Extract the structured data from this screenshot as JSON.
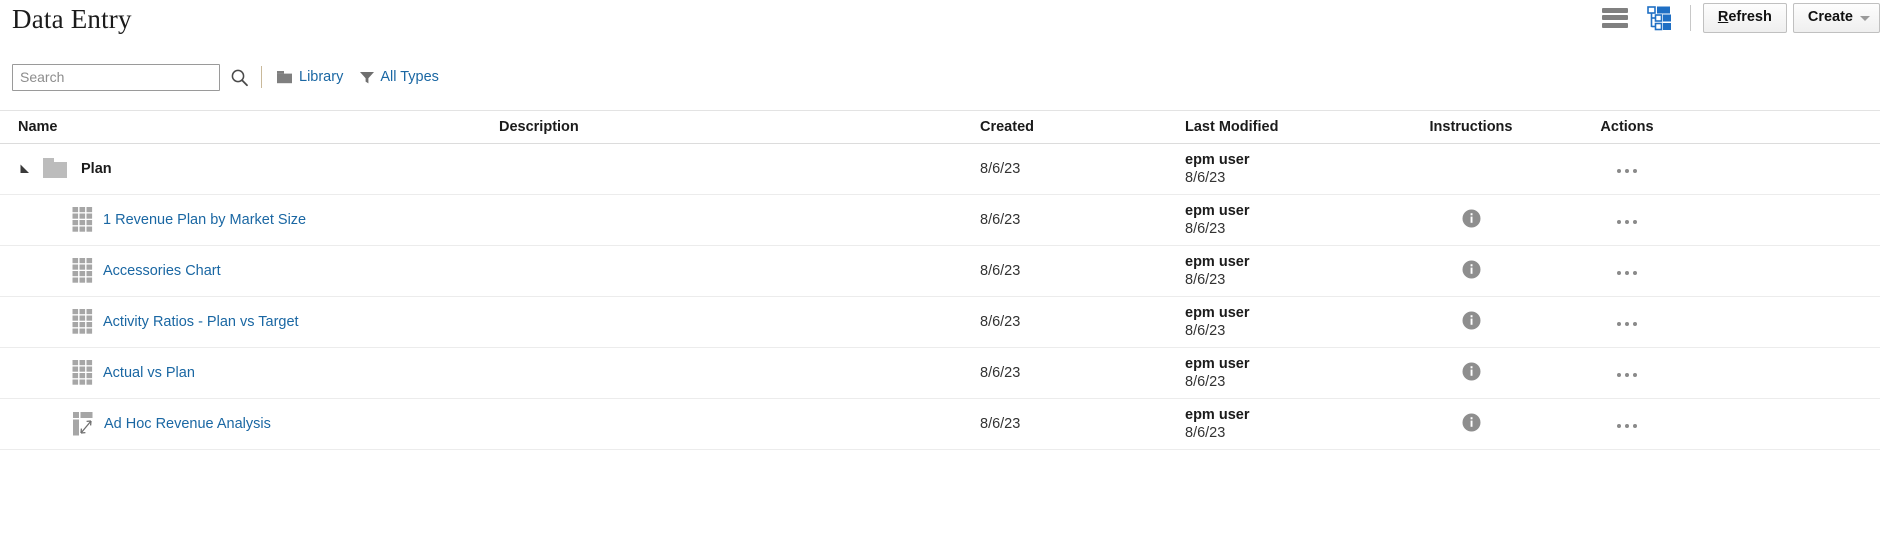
{
  "header": {
    "title": "Data Entry",
    "view_toggle": [
      {
        "name": "list-view-icon",
        "label": "List View",
        "selected": false
      },
      {
        "name": "tree-view-icon",
        "label": "Tree View",
        "selected": true
      }
    ],
    "refresh_label": "Refresh",
    "refresh_accesskey": "R",
    "refresh_rest": "efresh",
    "create_label": "Create"
  },
  "toolbar": {
    "search_placeholder": "Search",
    "search_value": "",
    "search_icon": "search-icon",
    "library_label": "Library",
    "library_icon": "folder-icon",
    "all_types_label": "All Types",
    "all_types_icon": "filter-funnel-icon"
  },
  "table": {
    "columns": {
      "name": "Name",
      "description": "Description",
      "created": "Created",
      "last_modified": "Last Modified",
      "instructions": "Instructions",
      "actions": "Actions"
    },
    "rows": [
      {
        "type": "folder",
        "icon": "folder-icon",
        "expanded": true,
        "name": "Plan",
        "description": "",
        "created": "8/6/23",
        "modified_user": "epm user",
        "modified_date": "8/6/23",
        "has_instructions": false
      },
      {
        "type": "form",
        "icon": "grid-icon",
        "name": "1 Revenue Plan by Market Size",
        "description": "",
        "created": "8/6/23",
        "modified_user": "epm user",
        "modified_date": "8/6/23",
        "has_instructions": true
      },
      {
        "type": "form",
        "icon": "grid-icon",
        "name": "Accessories Chart",
        "description": "",
        "created": "8/6/23",
        "modified_user": "epm user",
        "modified_date": "8/6/23",
        "has_instructions": true
      },
      {
        "type": "form",
        "icon": "grid-icon",
        "name": "Activity Ratios - Plan vs Target",
        "description": "",
        "created": "8/6/23",
        "modified_user": "epm user",
        "modified_date": "8/6/23",
        "has_instructions": true
      },
      {
        "type": "form",
        "icon": "grid-icon",
        "name": "Actual vs Plan",
        "description": "",
        "created": "8/6/23",
        "modified_user": "epm user",
        "modified_date": "8/6/23",
        "has_instructions": true
      },
      {
        "type": "adhoc",
        "icon": "adhoc-grid-icon",
        "name": "Ad Hoc Revenue Analysis",
        "description": "",
        "created": "8/6/23",
        "modified_user": "epm user",
        "modified_date": "8/6/23",
        "has_instructions": true
      }
    ]
  },
  "colors": {
    "link": "#1a67a3",
    "tree_icon_blue": "#1f6fc4",
    "icon_gray": "#a6a6a6",
    "text": "#1b1b1b"
  }
}
